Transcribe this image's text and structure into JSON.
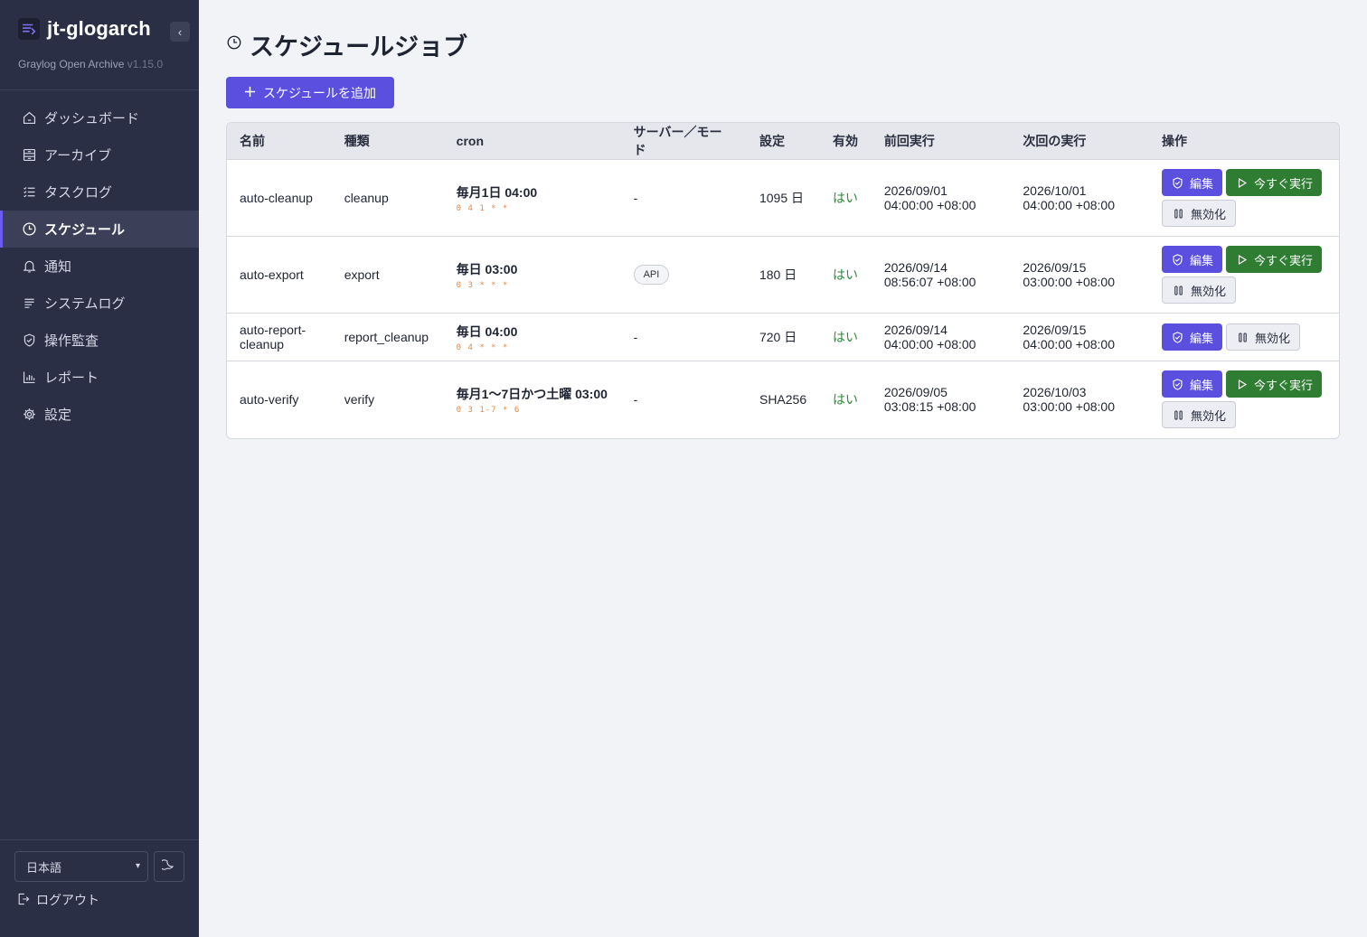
{
  "app": {
    "name": "jt-glogarch",
    "subtitle": "Graylog Open Archive",
    "version": "v1.15.0",
    "collapse_symbol": "‹"
  },
  "sidebar": {
    "items": [
      {
        "label": "ダッシュボード",
        "icon": "home-icon"
      },
      {
        "label": "アーカイブ",
        "icon": "archive-icon"
      },
      {
        "label": "タスクログ",
        "icon": "list-check-icon"
      },
      {
        "label": "スケジュール",
        "icon": "clock-icon",
        "active": true
      },
      {
        "label": "通知",
        "icon": "bell-icon"
      },
      {
        "label": "システムログ",
        "icon": "log-lines-icon"
      },
      {
        "label": "操作監査",
        "icon": "shield-check-icon"
      },
      {
        "label": "レポート",
        "icon": "bar-chart-icon"
      },
      {
        "label": "設定",
        "icon": "gear-icon"
      }
    ],
    "language": "日本語",
    "logout": "ログアウト"
  },
  "page": {
    "title": "スケジュールジョブ",
    "add_button": "スケジュールを追加"
  },
  "table": {
    "headers": [
      "名前",
      "種類",
      "cron",
      "サーバー／モード",
      "設定",
      "有効",
      "前回実行",
      "次回の実行",
      "操作"
    ],
    "rows": [
      {
        "name": "auto-cleanup",
        "type": "cleanup",
        "cron_human": "毎月1日 04:00",
        "cron_expr": "0 4 1 * *",
        "server_mode": "-",
        "setting": "1095 日",
        "enabled": "はい",
        "last_run_date": "2026/09/01",
        "last_run_time": "04:00:00 +08:00",
        "next_run_date": "2026/10/01",
        "next_run_time": "04:00:00 +08:00"
      },
      {
        "name": "auto-export",
        "type": "export",
        "cron_human": "毎日 03:00",
        "cron_expr": "0 3 * * *",
        "server_mode": "API",
        "setting": "180 日",
        "enabled": "はい",
        "last_run_date": "2026/09/14",
        "last_run_time": "08:56:07 +08:00",
        "next_run_date": "2026/09/15",
        "next_run_time": "03:00:00 +08:00"
      },
      {
        "name_line1": "auto-report-",
        "name_line2": "cleanup",
        "type": "report_cleanup",
        "cron_human": "毎日 04:00",
        "cron_expr": "0 4 * * *",
        "server_mode": "-",
        "setting": "720 日",
        "enabled": "はい",
        "last_run_date": "2026/09/14",
        "last_run_time": "04:00:00 +08:00",
        "next_run_date": "2026/09/15",
        "next_run_time": "04:00:00 +08:00"
      },
      {
        "name": "auto-verify",
        "type": "verify",
        "cron_human": "毎月1〜7日かつ土曜 03:00",
        "cron_expr": "0 3 1-7 * 6",
        "server_mode": "-",
        "setting": "SHA256",
        "enabled": "はい",
        "last_run_date": "2026/09/05",
        "last_run_time": "03:08:15 +08:00",
        "next_run_date": "2026/10/03",
        "next_run_time": "03:00:00 +08:00"
      }
    ],
    "actions": {
      "edit": "編集",
      "run_now": "今すぐ実行",
      "disable": "無効化"
    }
  },
  "colors": {
    "sidebar_bg": "#2b2f45",
    "accent": "#5b4fe0",
    "run_green": "#2f7d32",
    "enabled_green": "#2e8a3a",
    "cron_expr": "#e08a4a"
  }
}
